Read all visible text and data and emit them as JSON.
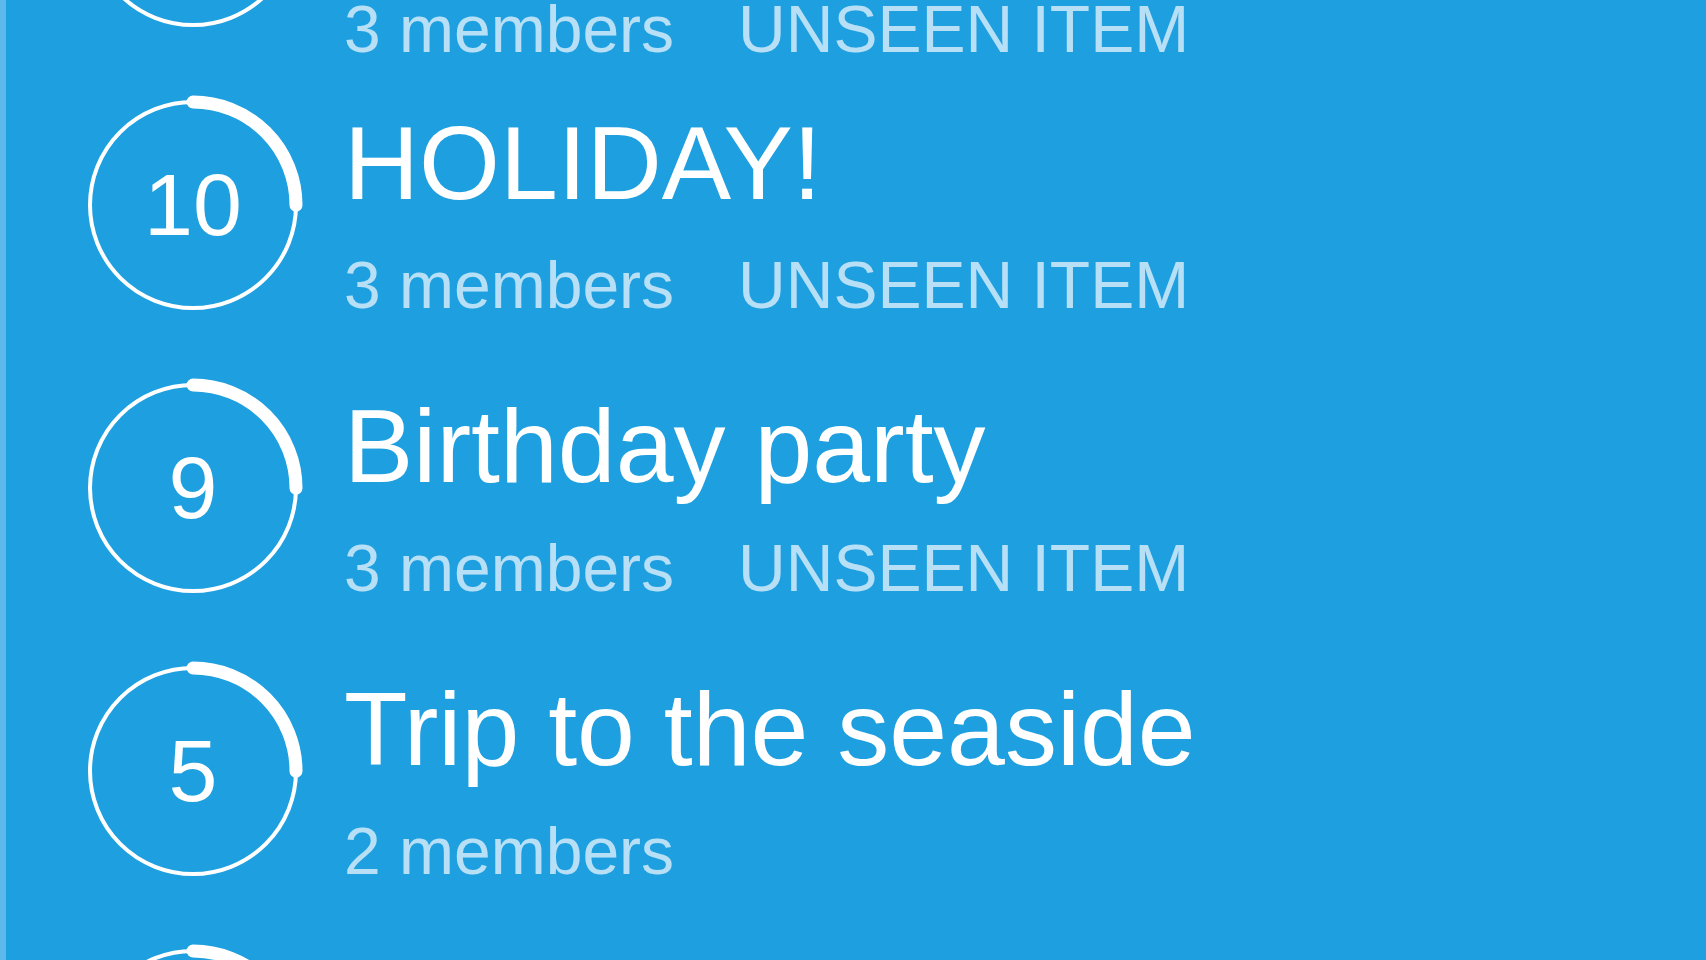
{
  "groups": [
    {
      "members": "3 members",
      "tag": "UNSEEN ITEM"
    },
    {
      "count": "10",
      "title": "HOLIDAY!",
      "members": "3 members",
      "tag": "UNSEEN ITEM"
    },
    {
      "count": "9",
      "title": "Birthday party",
      "members": "3 members",
      "tag": "UNSEEN ITEM"
    },
    {
      "count": "5",
      "title": "Trip to the seaside",
      "members": "2 members"
    }
  ]
}
